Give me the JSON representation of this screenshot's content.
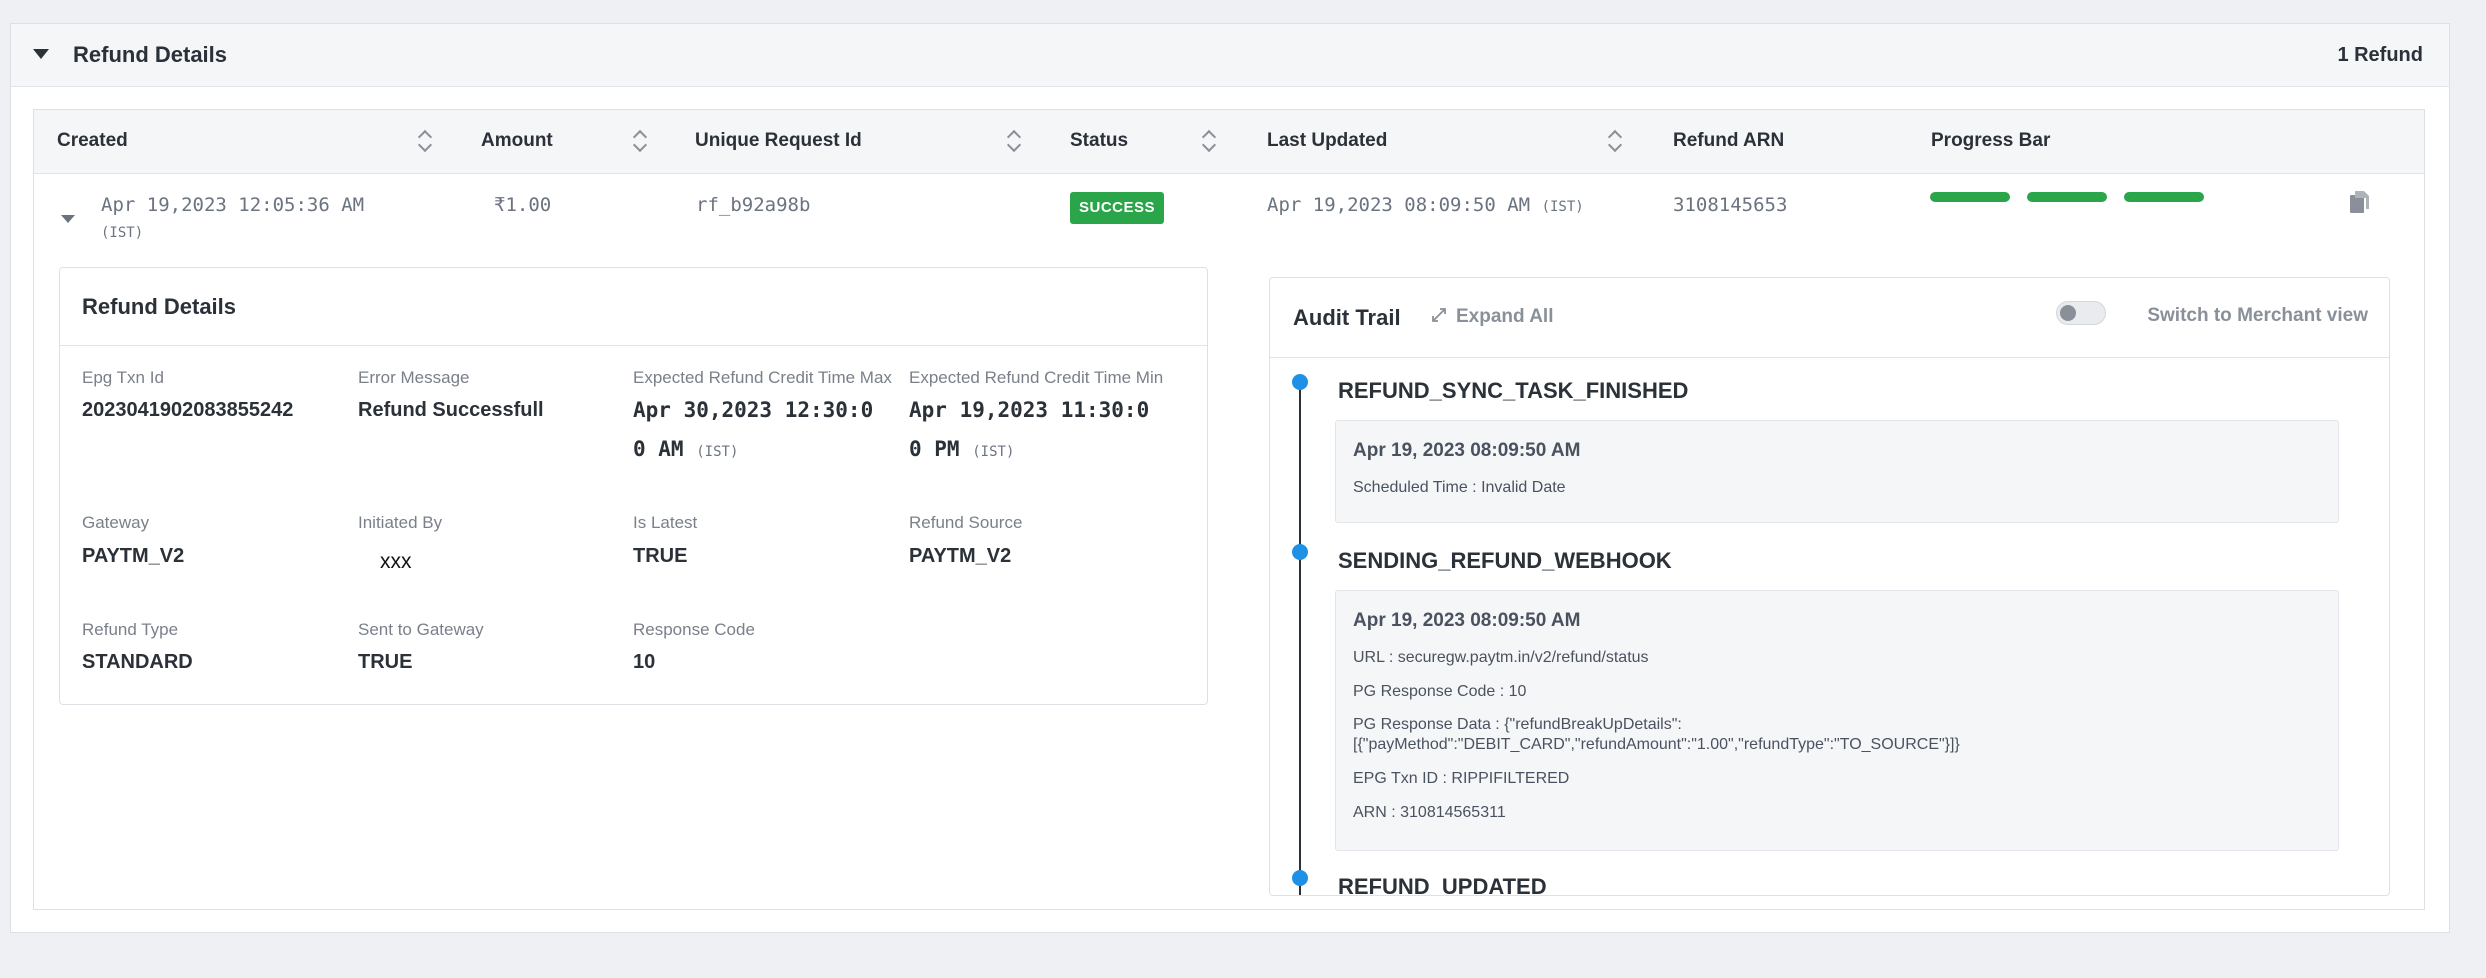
{
  "panel": {
    "title": "Refund Details",
    "count": "1 Refund"
  },
  "table": {
    "columns": [
      "Created",
      "Amount",
      "Unique Request Id",
      "Status",
      "Last Updated",
      "Refund ARN",
      "Progress Bar"
    ],
    "row": {
      "created": "Apr 19,2023 12:05:36 AM",
      "created_tz": "(IST)",
      "amount": "₹1.00",
      "request_id": "rf_b92a98b",
      "status": "SUCCESS",
      "last_updated": "Apr 19,2023 08:09:50 AM",
      "last_updated_tz": "(IST)",
      "arn": "3108145653",
      "progress_steps_complete": 3,
      "progress_steps_total": 3
    }
  },
  "details_card": {
    "title": "Refund Details",
    "fields": {
      "epg_txn_id": {
        "label": "Epg Txn Id",
        "value": "2023041902083855242"
      },
      "error_message": {
        "label": "Error Message",
        "value": "Refund Successfull"
      },
      "credit_time_max": {
        "label": "Expected Refund Credit Time Max",
        "line1": "Apr 30,2023 12:30:0",
        "line2": "0 AM",
        "tz": "(IST)"
      },
      "credit_time_min": {
        "label": "Expected Refund Credit Time Min",
        "line1": "Apr 19,2023 11:30:0",
        "line2": "0 PM",
        "tz": "(IST)"
      },
      "gateway": {
        "label": "Gateway",
        "value": "PAYTM_V2"
      },
      "initiated_by": {
        "label": "Initiated By",
        "value": "xxx"
      },
      "is_latest": {
        "label": "Is Latest",
        "value": "TRUE"
      },
      "refund_source": {
        "label": "Refund Source",
        "value": "PAYTM_V2"
      },
      "refund_type": {
        "label": "Refund Type",
        "value": "STANDARD"
      },
      "sent_to_gateway": {
        "label": "Sent to Gateway",
        "value": "TRUE"
      },
      "response_code": {
        "label": "Response Code",
        "value": "10"
      }
    }
  },
  "audit_trail": {
    "title": "Audit Trail",
    "expand_all": "Expand All",
    "switch_label": "Switch to Merchant view",
    "switch_on": false,
    "events": [
      {
        "title": "REFUND_SYNC_TASK_FINISHED",
        "time": "Apr 19, 2023 08:09:50 AM",
        "lines": [
          "Scheduled Time : Invalid Date"
        ]
      },
      {
        "title": "SENDING_REFUND_WEBHOOK",
        "time": "Apr 19, 2023 08:09:50 AM",
        "lines": [
          "URL : securegw.paytm.in/v2/refund/status",
          "PG Response Code : 10",
          "PG Response Data : {\"refundBreakUpDetails\":\n[{\"payMethod\":\"DEBIT_CARD\",\"refundAmount\":\"1.00\",\"refundType\":\"TO_SOURCE\"}]}",
          "EPG Txn ID : RIPPIFILTERED",
          "ARN : 310814565311"
        ]
      },
      {
        "title": "REFUND_UPDATED",
        "time": "",
        "lines": []
      }
    ]
  },
  "colors": {
    "success": "#2aa54a",
    "timeline_dot": "#1e90e6",
    "header_bg": "#f5f6f8"
  },
  "icons": {
    "collapse": "caret-down-icon",
    "sort": "sort-icon",
    "copy": "copy-icon",
    "expand": "expand-arrows-icon"
  }
}
